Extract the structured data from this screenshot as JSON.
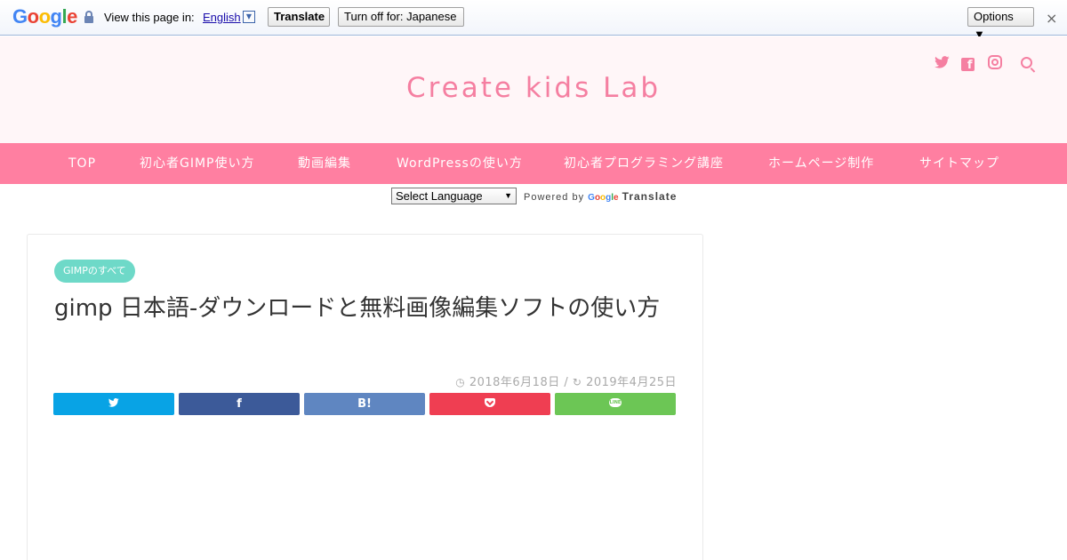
{
  "translate_bar": {
    "logo": [
      "G",
      "o",
      "o",
      "g",
      "l",
      "e"
    ],
    "prompt": "View this page in:",
    "language": "English",
    "translate_button": "Translate",
    "turn_off_button": "Turn off for: Japanese",
    "options_button": "Options ▼",
    "close": "×"
  },
  "header": {
    "site_title": "Create kids Lab",
    "social_icons": [
      "twitter-icon",
      "facebook-icon",
      "instagram-icon",
      "search-icon"
    ],
    "accent_color": "#f57fa1"
  },
  "nav": {
    "items": [
      "TOP",
      "初心者GIMP使い方",
      "動画編集",
      "WordPressの使い方",
      "初心者プログラミング講座",
      "ホームページ制作",
      "サイトマップ"
    ],
    "background": "#ff7fa1"
  },
  "language_widget": {
    "select_value": "Select Language",
    "powered_by": "Powered by",
    "google": [
      "G",
      "o",
      "o",
      "g",
      "l",
      "e"
    ],
    "translate": "Translate"
  },
  "article": {
    "category": "GIMPのすべて",
    "title": "gimp 日本語-ダウンロードと無料画像編集ソフトの使い方",
    "published": "2018年6月18日",
    "separator": "/",
    "updated": "2019年4月25日",
    "share": {
      "twitter": "",
      "facebook": "f",
      "hatena": "B!",
      "pocket": "",
      "line": "LINE"
    }
  }
}
